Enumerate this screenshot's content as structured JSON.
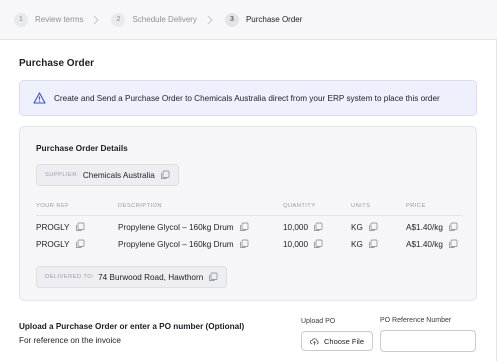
{
  "stepper": {
    "steps": [
      {
        "num": "1",
        "label": "Review terms"
      },
      {
        "num": "2",
        "label": "Schedule Delivery"
      },
      {
        "num": "3",
        "label": "Purchase Order"
      }
    ]
  },
  "page": {
    "title": "Purchase Order"
  },
  "banner": {
    "icon": "warning-triangle-icon",
    "text": "Create and Send a Purchase Order to Chemicals Australia direct from your ERP system to place this order"
  },
  "details": {
    "title": "Purchase Order Details",
    "supplier_key": "SUPPLIER:",
    "supplier_value": "Chemicals Australia",
    "columns": [
      "YOUR REF",
      "DESCRIPTION",
      "QUANTITY",
      "UNITS",
      "PRICE"
    ],
    "rows": [
      {
        "ref": "PROGLY",
        "description": "Propylene Glycol –  160kg Drum",
        "quantity": "10,000",
        "units": "KG",
        "price": "A$1.40/kg"
      },
      {
        "ref": "PROGLY",
        "description": "Propylene Glycol –  160kg Drum",
        "quantity": "10,000",
        "units": "KG",
        "price": "A$1.40/kg"
      }
    ],
    "delivered_key": "DELIVERED TO:",
    "delivered_value": "74 Burwood Road, Hawthorn"
  },
  "upload": {
    "title": "Upload a Purchase Order or enter a PO number (Optional)",
    "subtitle": "For reference on the invoice",
    "upload_label": "Upload PO",
    "choose_button": "Choose File",
    "po_label": "PO Reference Number",
    "po_value": "",
    "po_placeholder": ""
  },
  "colors": {
    "accent": "#3c4bd6",
    "banner_bg": "#eef0fc",
    "panel_bg": "#f6f6f8"
  }
}
